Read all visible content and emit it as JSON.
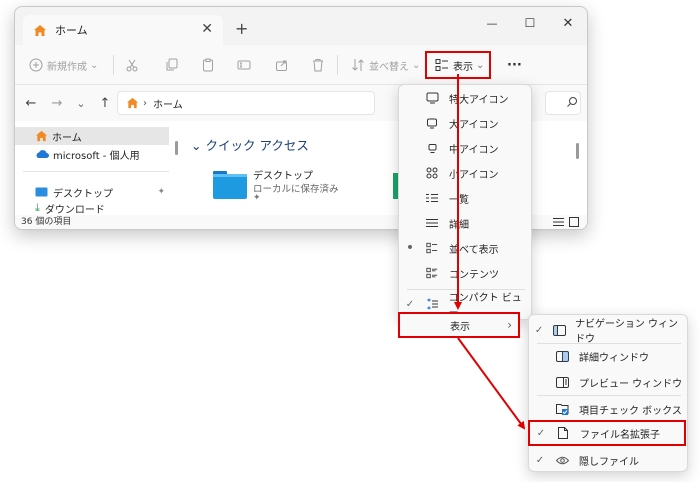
{
  "window": {
    "tab_label": "ホーム",
    "tab_close": "✕",
    "new_tab": "+",
    "minimize": "—",
    "maximize": "☐",
    "close": "✕"
  },
  "toolbar": {
    "new_label": "新規作成",
    "sort_label": "並べ替え",
    "view_label": "表示",
    "more_label": "···"
  },
  "address": {
    "breadcrumb_sep": "›",
    "location": "ホーム"
  },
  "nav": {
    "items": [
      {
        "label": "ホーム"
      },
      {
        "label": "microsoft - 個人用"
      },
      {
        "label": "デスクトップ"
      },
      {
        "label": "ダウンロード"
      }
    ]
  },
  "main": {
    "quick_access": "クイック アクセス",
    "folder_name": "デスクトップ",
    "folder_sub": "ローカルに保存済み"
  },
  "status": {
    "count": "36 個の項目"
  },
  "view_menu": {
    "items": [
      {
        "label": "特大アイコン",
        "checked": ""
      },
      {
        "label": "大アイコン",
        "checked": ""
      },
      {
        "label": "中アイコン",
        "checked": ""
      },
      {
        "label": "小アイコン",
        "checked": ""
      },
      {
        "label": "一覧",
        "checked": ""
      },
      {
        "label": "詳細",
        "checked": ""
      },
      {
        "label": "並べて表示",
        "checked": "•"
      },
      {
        "label": "コンテンツ",
        "checked": ""
      },
      {
        "label": "コンパクト ビュー",
        "checked": "✓"
      },
      {
        "label": "表示",
        "checked": "",
        "arrow": "›"
      }
    ]
  },
  "show_menu": {
    "items": [
      {
        "label": "ナビゲーション ウィンドウ",
        "checked": "✓"
      },
      {
        "label": "詳細ウィンドウ",
        "checked": ""
      },
      {
        "label": "プレビュー ウィンドウ",
        "checked": ""
      },
      {
        "label": "項目チェック ボックス",
        "checked": ""
      },
      {
        "label": "ファイル名拡張子",
        "checked": "✓"
      },
      {
        "label": "隠しファイル",
        "checked": "✓"
      }
    ]
  },
  "colors": {
    "highlight": "#e00000",
    "folder": "#1e9be0",
    "home": "#f08a24"
  }
}
